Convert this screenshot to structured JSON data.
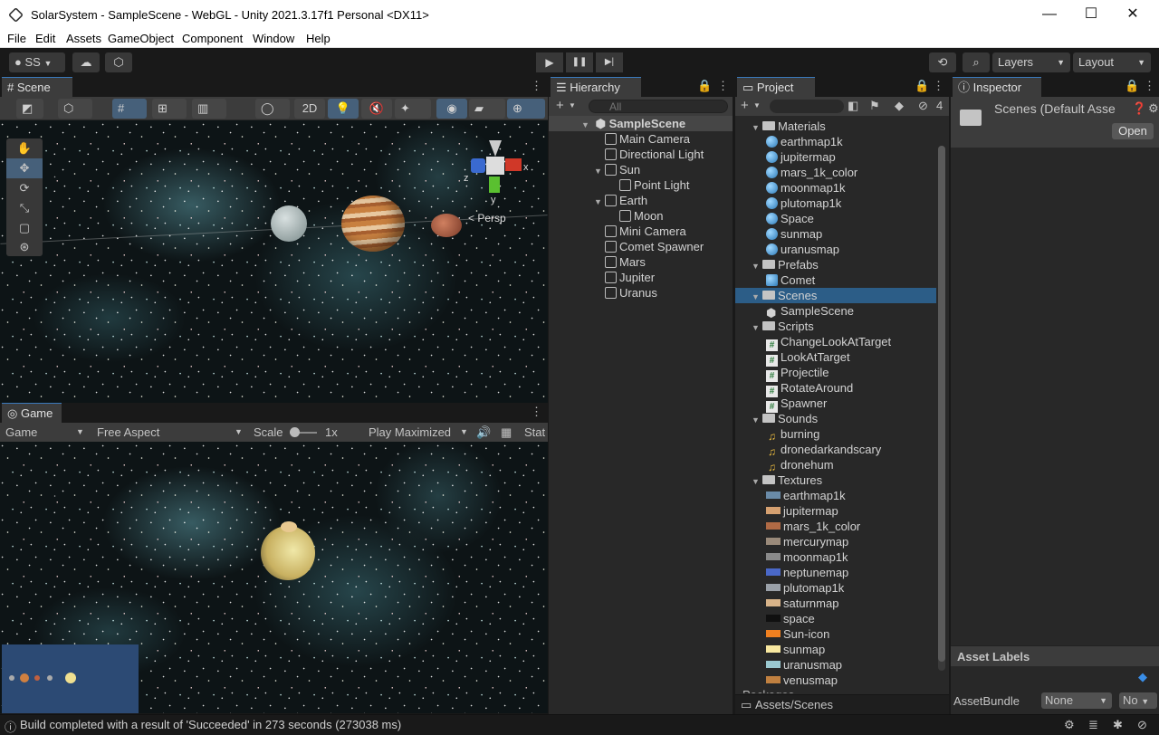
{
  "window": {
    "title": "SolarSystem - SampleScene - WebGL - Unity 2021.3.17f1 Personal <DX11>",
    "controls": {
      "minimize": "—",
      "maximize": "☐",
      "close": "✕"
    }
  },
  "menu": [
    "File",
    "Edit",
    "Assets",
    "GameObject",
    "Component",
    "Window",
    "Help"
  ],
  "toolbar": {
    "account_label": "SS",
    "layers_label": "Layers",
    "layout_label": "Layout",
    "play_icons": {
      "play": "▶",
      "pause": "❚❚",
      "step": "▶|"
    }
  },
  "scene": {
    "tab_label": "Scene",
    "mode_2d": "2D",
    "persp_label": "< Persp",
    "axis_labels": {
      "x": "x",
      "y": "y",
      "z": "z"
    }
  },
  "game": {
    "tab_label": "Game",
    "display": "Game",
    "aspect": "Free Aspect",
    "scale_label": "Scale",
    "scale_value": "1x",
    "play_mode": "Play Maximized",
    "stats": "Stat"
  },
  "hierarchy": {
    "tab_label": "Hierarchy",
    "search_placeholder": "All",
    "scene_name": "SampleScene",
    "items": [
      {
        "label": "Main Camera",
        "depth": 1,
        "expand": ""
      },
      {
        "label": "Directional Light",
        "depth": 1,
        "expand": ""
      },
      {
        "label": "Sun",
        "depth": 1,
        "expand": "▼"
      },
      {
        "label": "Point Light",
        "depth": 2,
        "expand": ""
      },
      {
        "label": "Earth",
        "depth": 1,
        "expand": "▼"
      },
      {
        "label": "Moon",
        "depth": 2,
        "expand": ""
      },
      {
        "label": "Mini Camera",
        "depth": 1,
        "expand": ""
      },
      {
        "label": "Comet Spawner",
        "depth": 1,
        "expand": ""
      },
      {
        "label": "Mars",
        "depth": 1,
        "expand": ""
      },
      {
        "label": "Jupiter",
        "depth": 1,
        "expand": ""
      },
      {
        "label": "Uranus",
        "depth": 1,
        "expand": ""
      }
    ]
  },
  "project": {
    "tab_label": "Project",
    "hidden_count": "4",
    "breadcrumb": "Assets/Scenes",
    "items": [
      {
        "label": "Materials",
        "kind": "folder",
        "depth": 0
      },
      {
        "label": "earthmap1k",
        "kind": "mat",
        "depth": 1
      },
      {
        "label": "jupitermap",
        "kind": "mat",
        "depth": 1
      },
      {
        "label": "mars_1k_color",
        "kind": "mat",
        "depth": 1
      },
      {
        "label": "moonmap1k",
        "kind": "mat",
        "depth": 1
      },
      {
        "label": "plutomap1k",
        "kind": "mat",
        "depth": 1
      },
      {
        "label": "Space",
        "kind": "mat",
        "depth": 1
      },
      {
        "label": "sunmap",
        "kind": "mat",
        "depth": 1
      },
      {
        "label": "uranusmap",
        "kind": "mat",
        "depth": 1
      },
      {
        "label": "Prefabs",
        "kind": "folder",
        "depth": 0
      },
      {
        "label": "Comet",
        "kind": "prefab",
        "depth": 1
      },
      {
        "label": "Scenes",
        "kind": "folder",
        "depth": 0,
        "selected": true
      },
      {
        "label": "SampleScene",
        "kind": "unity",
        "depth": 1
      },
      {
        "label": "Scripts",
        "kind": "folder",
        "depth": 0
      },
      {
        "label": "ChangeLookAtTarget",
        "kind": "script",
        "depth": 1
      },
      {
        "label": "LookAtTarget",
        "kind": "script",
        "depth": 1
      },
      {
        "label": "Projectile",
        "kind": "script",
        "depth": 1
      },
      {
        "label": "RotateAround",
        "kind": "script",
        "depth": 1
      },
      {
        "label": "Spawner",
        "kind": "script",
        "depth": 1
      },
      {
        "label": "Sounds",
        "kind": "folder",
        "depth": 0
      },
      {
        "label": "burning",
        "kind": "audio",
        "depth": 1
      },
      {
        "label": "dronedarkandscary",
        "kind": "audio",
        "depth": 1
      },
      {
        "label": "dronehum",
        "kind": "audio",
        "depth": 1
      },
      {
        "label": "Textures",
        "kind": "folder",
        "depth": 0
      },
      {
        "label": "earthmap1k",
        "kind": "tex",
        "color": "#6a8ba8",
        "depth": 1
      },
      {
        "label": "jupitermap",
        "kind": "tex",
        "color": "#d5a070",
        "depth": 1
      },
      {
        "label": "mars_1k_color",
        "kind": "tex",
        "color": "#b06a45",
        "depth": 1
      },
      {
        "label": "mercurymap",
        "kind": "tex",
        "color": "#9a8a7a",
        "depth": 1
      },
      {
        "label": "moonmap1k",
        "kind": "tex",
        "color": "#8a8a8a",
        "depth": 1
      },
      {
        "label": "neptunemap",
        "kind": "tex",
        "color": "#4a68c8",
        "depth": 1
      },
      {
        "label": "plutomap1k",
        "kind": "tex",
        "color": "#9aa0a8",
        "depth": 1
      },
      {
        "label": "saturnmap",
        "kind": "tex",
        "color": "#d8b48a",
        "depth": 1
      },
      {
        "label": "space",
        "kind": "tex",
        "color": "#101010",
        "depth": 1
      },
      {
        "label": "Sun-icon",
        "kind": "tex",
        "color": "#f08020",
        "depth": 1
      },
      {
        "label": "sunmap",
        "kind": "tex",
        "color": "#f8e8a0",
        "depth": 1
      },
      {
        "label": "uranusmap",
        "kind": "tex",
        "color": "#9ac8d0",
        "depth": 1
      },
      {
        "label": "venusmap",
        "kind": "tex",
        "color": "#c08040",
        "depth": 1
      }
    ],
    "cutoff_label": "Packages"
  },
  "inspector": {
    "tab_label": "Inspector",
    "asset_title": "Scenes (Default Asse",
    "open_button": "Open",
    "asset_labels": "Asset Labels",
    "asset_bundle_label": "AssetBundle",
    "bundle_value": "None",
    "variant_value": "No"
  },
  "status": {
    "message": "Build completed with a result of 'Succeeded' in 273 seconds (273038 ms)"
  },
  "colors": {
    "selection": "#2c5d87",
    "panel_bg": "#282828",
    "tab_bg": "#3c3c3c"
  }
}
